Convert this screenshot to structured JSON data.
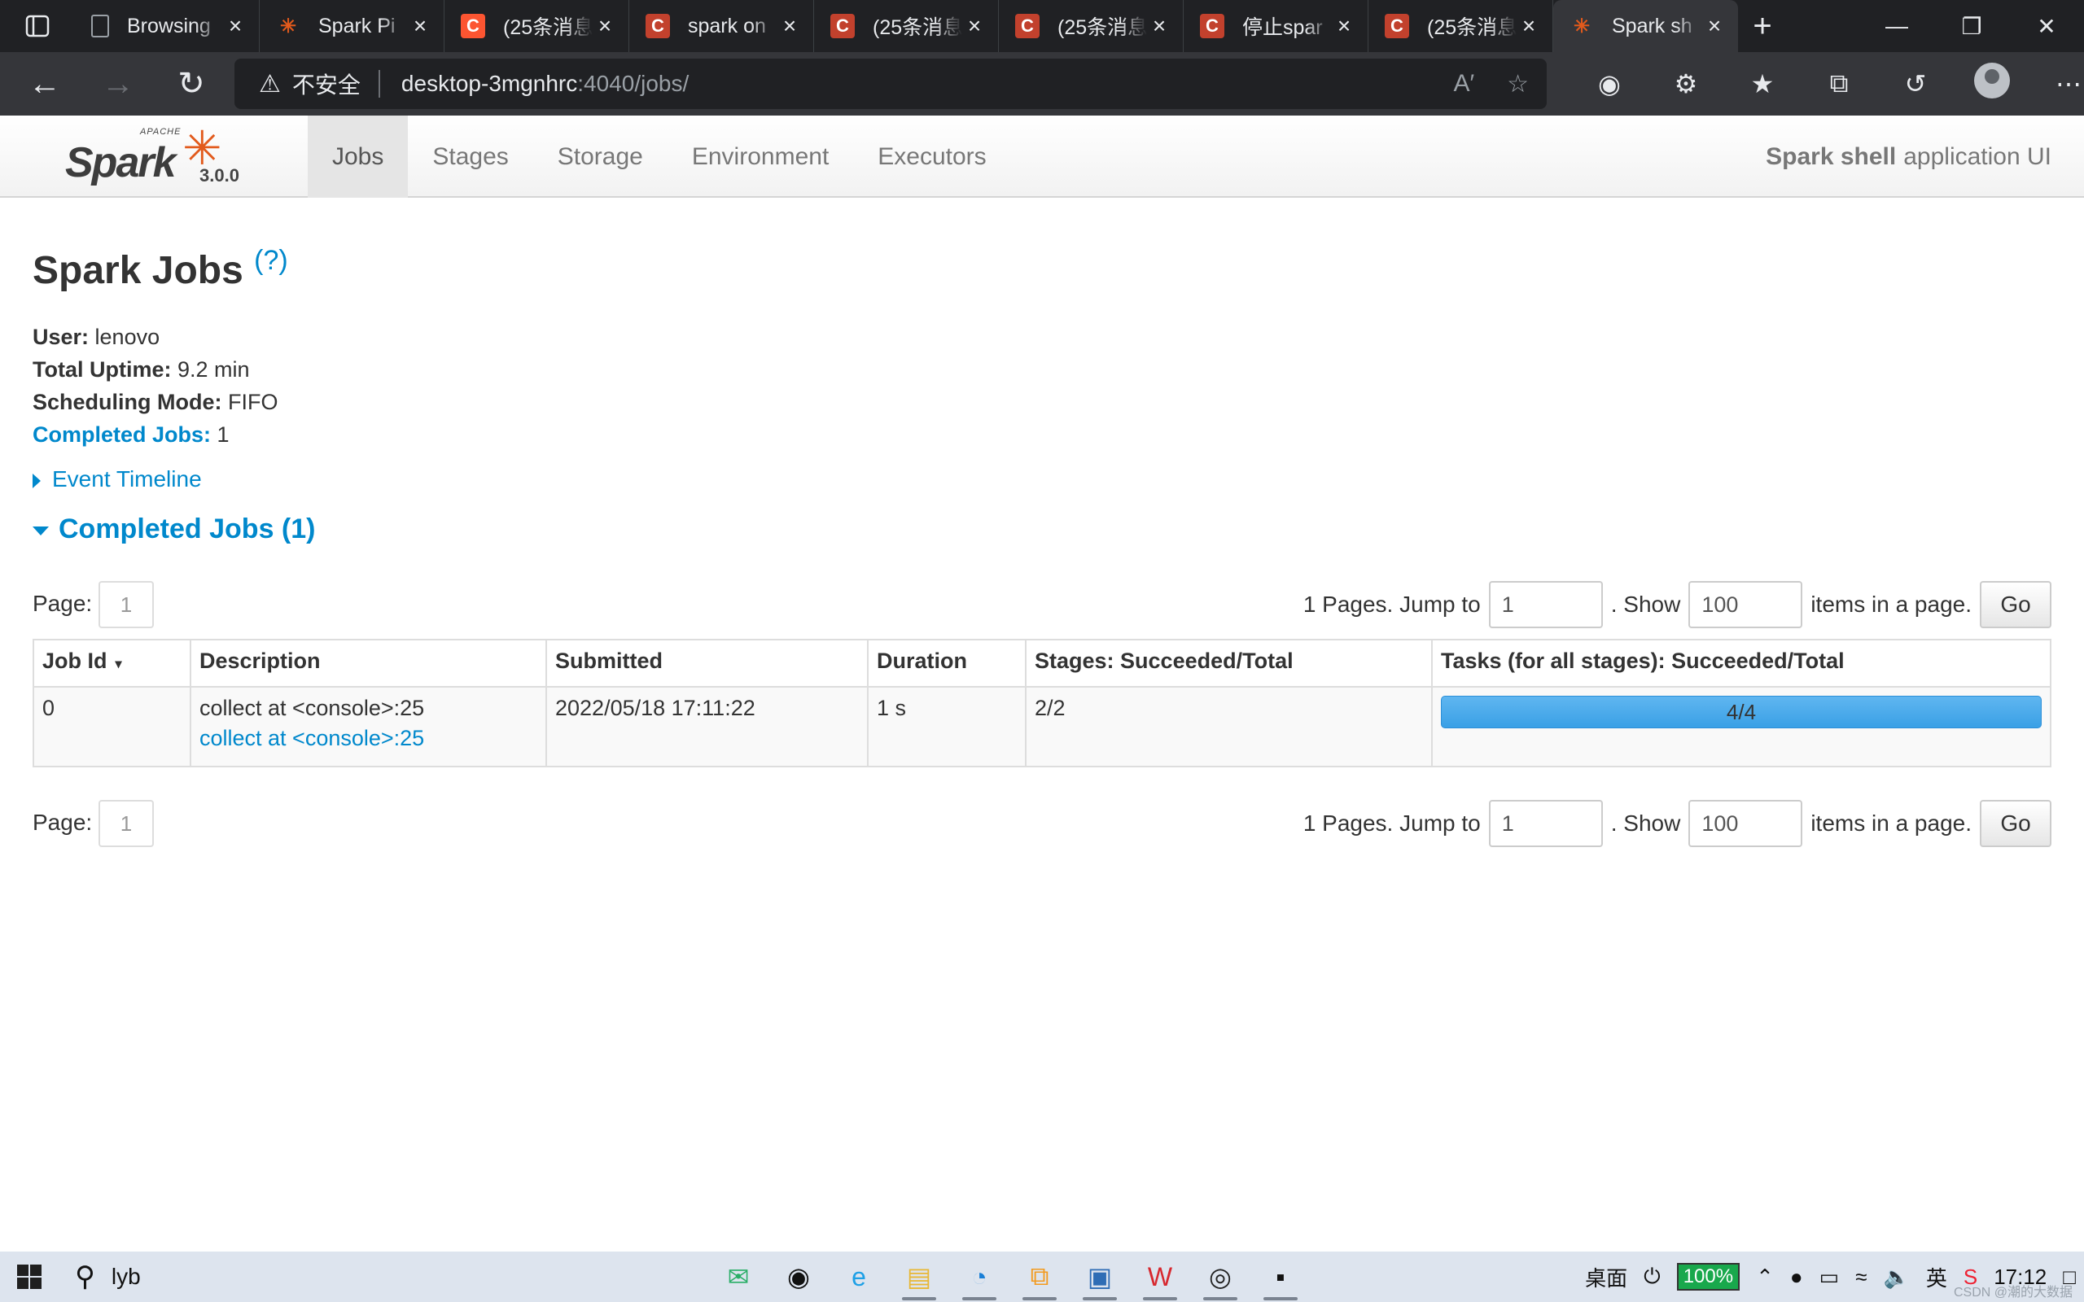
{
  "browser": {
    "tabs": [
      {
        "title": "Browsing",
        "icon": "document-icon",
        "favicon_type": "doc"
      },
      {
        "title": "Spark Pi",
        "icon": "spark-favicon-icon",
        "favicon_type": "sparkfav"
      },
      {
        "title": "(25条消息",
        "icon": "csdn-favicon-icon",
        "favicon_type": "csdn-active"
      },
      {
        "title": "spark on",
        "icon": "csdn-favicon-icon",
        "favicon_type": "csdn"
      },
      {
        "title": "(25条消息",
        "icon": "csdn-favicon-icon",
        "favicon_type": "csdn"
      },
      {
        "title": "(25条消息",
        "icon": "csdn-favicon-icon",
        "favicon_type": "csdn"
      },
      {
        "title": "停止spar",
        "icon": "csdn-favicon-icon",
        "favicon_type": "csdn"
      },
      {
        "title": "(25条消息",
        "icon": "csdn-favicon-icon",
        "favicon_type": "csdn"
      },
      {
        "title": "Spark sh",
        "icon": "spark-favicon-icon",
        "favicon_type": "sparkfav",
        "active": true
      }
    ],
    "address": {
      "security_label": "不安全",
      "host": "desktop-3mgnhrc",
      "path": ":4040/jobs/"
    }
  },
  "spark": {
    "version": "3.0.0",
    "logo_top": "APACHE",
    "logo_word": "Spark",
    "nav": [
      "Jobs",
      "Stages",
      "Storage",
      "Environment",
      "Executors"
    ],
    "active_nav": "Jobs",
    "app_name_bold": "Spark shell",
    "app_name_rest": "application UI",
    "title": "Spark Jobs",
    "help": "(?)",
    "user_label": "User:",
    "user": "lenovo",
    "uptime_label": "Total Uptime:",
    "uptime": "9.2 min",
    "mode_label": "Scheduling Mode:",
    "mode": "FIFO",
    "completed_label": "Completed Jobs:",
    "completed": "1",
    "event_timeline": "Event Timeline",
    "section_title": "Completed Jobs (1)",
    "pager": {
      "page_label": "Page:",
      "page": "1",
      "pages_text": "1 Pages. Jump to",
      "jump_value": "1",
      "show_label": ". Show",
      "show_value": "100",
      "items_label": "items in a page.",
      "go": "Go"
    },
    "table": {
      "headers": [
        "Job Id",
        "Description",
        "Submitted",
        "Duration",
        "Stages: Succeeded/Total",
        "Tasks (for all stages): Succeeded/Total"
      ],
      "sort_arrow": "▾",
      "rows": [
        {
          "job_id": "0",
          "desc": "collect at <console>:25",
          "desc_link": "collect at <console>:25",
          "submitted": "2022/05/18 17:11:22",
          "duration": "1 s",
          "stages": "2/2",
          "tasks": "4/4",
          "tasks_fraction": 1.0
        }
      ]
    }
  },
  "taskbar": {
    "search_text": "lyb",
    "apps": [
      "wechat-icon",
      "qq-icon",
      "ie-icon",
      "file-explorer-icon",
      "edge-icon",
      "vmware-icon",
      "remote-desktop-icon",
      "wps-icon",
      "github-icon",
      "terminal-icon"
    ],
    "desktop_label": "桌面",
    "battery": "100%",
    "ime": "英",
    "time": "17:12",
    "watermark": "CSDN @潮的大数据"
  }
}
